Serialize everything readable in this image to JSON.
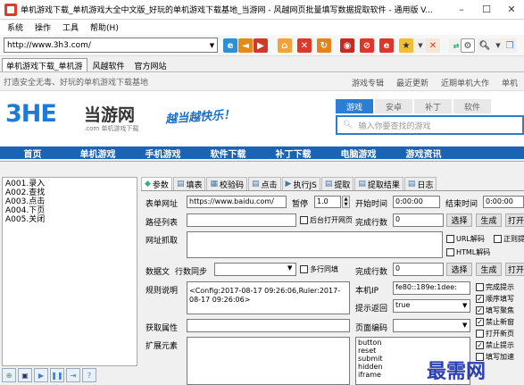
{
  "window": {
    "title": "单机游戏下载_单机游戏大全中文版_好玩的单机游戏下载基地_当游网 - 风越网页批量填写数据提取软件 - 通用版 V...",
    "minimize": "–",
    "maximize": "☐",
    "close": "✕"
  },
  "menu": [
    "系统",
    "操作",
    "工具",
    "帮助(H)"
  ],
  "address": {
    "value": "http://www.3h3.com/"
  },
  "tabs": [
    "单机游戏下载_单机游",
    "风越软件",
    "官方网站"
  ],
  "web": {
    "top_tagline": "打造安全无毒、好玩的单机游戏下载基地",
    "top_links": [
      "游戏专辑",
      "最近更新",
      "近期单机大作",
      "单机"
    ],
    "logo_text": "3HE",
    "logo_name": "当游网",
    "logo_sub": ".com 单机游戏下载",
    "slogan": "越当越快乐！",
    "search_tabs": [
      "游戏",
      "安卓",
      "补丁",
      "软件"
    ],
    "search_placeholder": "输入你要查找的游戏",
    "nav": [
      "首页",
      "单机游戏",
      "手机游戏",
      "软件下载",
      "补丁下载",
      "电脑游戏",
      "游戏资讯"
    ]
  },
  "commands": [
    "A001.录入",
    "A002.查找",
    "A003.点击",
    "A004.下页",
    "A005.关闭"
  ],
  "panel_tabs": [
    "参数",
    "填表",
    "校验码",
    "点击",
    "执行JS",
    "提取",
    "提取结果",
    "日志"
  ],
  "form": {
    "url_label": "表单网址",
    "url_value": "https://www.baidu.com/",
    "pause_label": "暂停",
    "pause_value": "1.0",
    "start_label": "开始时间",
    "start_value": "0:00:00",
    "end_label": "结束时间",
    "end_value": "0:00:00",
    "path_label": "路径列表",
    "bg_open_label": "后台打开网页",
    "done_label": "完成行数",
    "done_value": "0",
    "select_btn": "选择",
    "generate_btn": "生成",
    "open_btn": "打开",
    "crawl_label": "网址抓取",
    "url_decode": "URL解码",
    "regex_extract": "正则提",
    "html_decode": "HTML解码",
    "data_label": "数据文",
    "row_sync": "行数同步",
    "multi_row": "多行同填",
    "rule_label": "规则说明",
    "rule_text": "<Config:2017-08-17 09:26:06,Ruler:2017-08-17 09:26:06>",
    "ip_label": "本机IP",
    "ip_value": "fe80::189e:1dee:",
    "hint_label": "提示返回",
    "hint_value": "true",
    "get_attr_label": "获取属性",
    "encoding_label": "页面编码",
    "ext_label": "扩展元素",
    "elements": [
      "button",
      "reset",
      "submit",
      "hidden",
      "iframe"
    ],
    "options": [
      {
        "label": "完成提示",
        "checked": false
      },
      {
        "label": "顺序填写",
        "checked": true
      },
      {
        "label": "填写聚焦",
        "checked": true
      },
      {
        "label": "禁止新窗",
        "checked": true
      },
      {
        "label": "打开新页",
        "checked": false
      },
      {
        "label": "禁止提示",
        "checked": true
      },
      {
        "label": "填写加速",
        "checked": false
      }
    ]
  },
  "watermark": "最需网"
}
